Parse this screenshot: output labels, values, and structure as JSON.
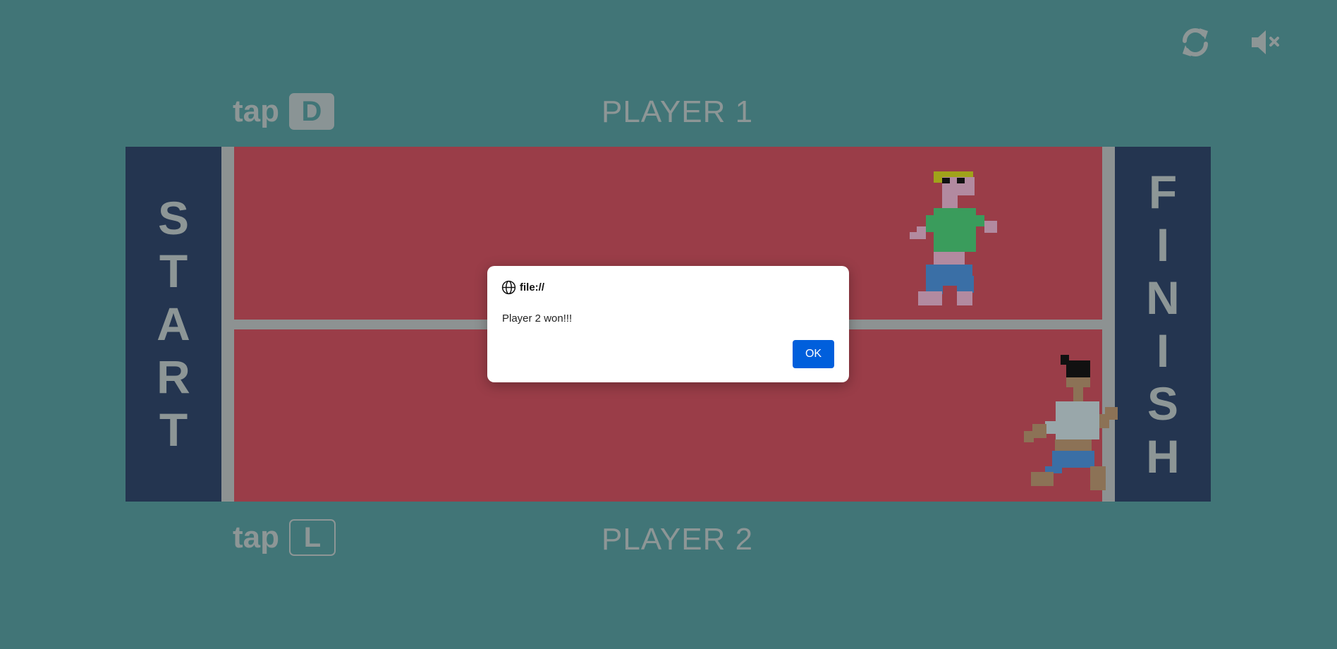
{
  "controls": {
    "restart_icon": "refresh-icon",
    "mute_icon": "speaker-muted-icon"
  },
  "players": [
    {
      "label": "PLAYER 1",
      "tap_text": "tap",
      "key": "D"
    },
    {
      "label": "PLAYER 2",
      "tap_text": "tap",
      "key": "L"
    }
  ],
  "track": {
    "start_letters": [
      "S",
      "T",
      "A",
      "R",
      "T"
    ],
    "finish_letters": [
      "F",
      "I",
      "N",
      "I",
      "S",
      "H"
    ]
  },
  "dialog": {
    "origin": "file://",
    "message": "Player 2 won!!!",
    "ok_label": "OK"
  },
  "colors": {
    "background": "#417577",
    "track": "#9a3d48",
    "endzone": "#243550",
    "text": "#8d9696",
    "ok_button": "#005fdc"
  }
}
